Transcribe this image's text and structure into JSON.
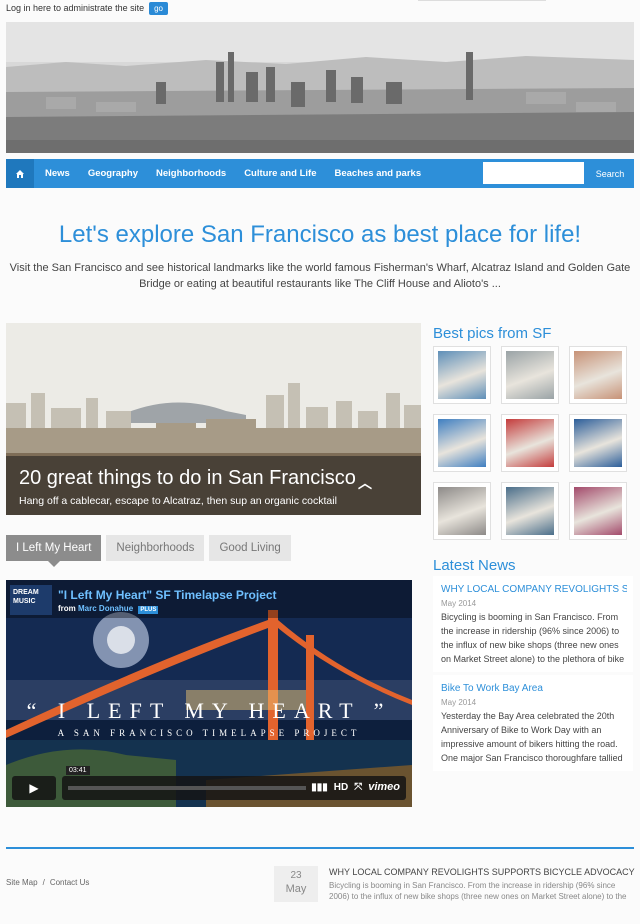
{
  "login": {
    "text": "Log in here to administrate the site",
    "button": "go"
  },
  "nav": {
    "items": [
      "News",
      "Geography",
      "Neighborhoods",
      "Culture and Life",
      "Beaches and parks"
    ],
    "search_placeholder": "",
    "search_button": "Search"
  },
  "headline": "Let's explore San Francisco as best place for life!",
  "intro": "Visit the San Francisco and see historical landmarks like the world famous Fisherman's Wharf, Alcatraz Island and Golden Gate Bridge or eating at beautiful restaurants like The Cliff House and Alioto's ...",
  "feature": {
    "title": "20 great things to do in San Francisco",
    "subtitle": "Hang off a cablecar, escape to Alcatraz, then sup an organic cocktail"
  },
  "tabs": [
    "I Left My Heart",
    "Neighborhoods",
    "Good Living"
  ],
  "video": {
    "badge": "DREAM MUSIC",
    "title": "\"I Left My Heart\" SF Timelapse Project",
    "from": "from",
    "author": "Marc Donahue",
    "plus": "PLUS",
    "big_title": "“ I LEFT MY HEART ”",
    "small_title": "A SAN FRANCISCO TIMELAPSE PROJECT",
    "time": "03:41",
    "hd": "HD",
    "brand": "vimeo"
  },
  "sidebar": {
    "pics_heading": "Best pics from SF",
    "pic_colors": [
      "#5e8fb8",
      "#9aa3a6",
      "#c79277",
      "#3f7fc1",
      "#c43c3c",
      "#2c5e9a",
      "#8d8a88",
      "#4a6e8a",
      "#a34a6b"
    ],
    "news_heading": "Latest News",
    "news": [
      {
        "title": "WHY LOCAL COMPANY REVOLIGHTS S...",
        "date": "May 2014",
        "body": "Bicycling is booming in San Francisco. From the increase in ridership (96% since 2006) to the influx of new bike shops (three new ones on Market Street alone) to the plethora of bike"
      },
      {
        "title": "Bike To Work Bay Area",
        "date": "May 2014",
        "body": "Yesterday the Bay Area celebrated the 20th Anniversary of Bike to Work Day with an impressive amount of bikers hitting the road. One major San Francisco thoroughfare tallied"
      }
    ]
  },
  "footer": {
    "links": [
      "Site Map",
      "/",
      "Contact Us"
    ],
    "day": "23",
    "month": "May",
    "news_title": "WHY LOCAL COMPANY REVOLIGHTS SUPPORTS BICYCLE ADVOCACY",
    "news_body": "Bicycling is booming in San Francisco. From the increase in ridership (96% since 2006) to the influx of new bike shops (three new ones on Market Street alone) to the plethora of"
  }
}
